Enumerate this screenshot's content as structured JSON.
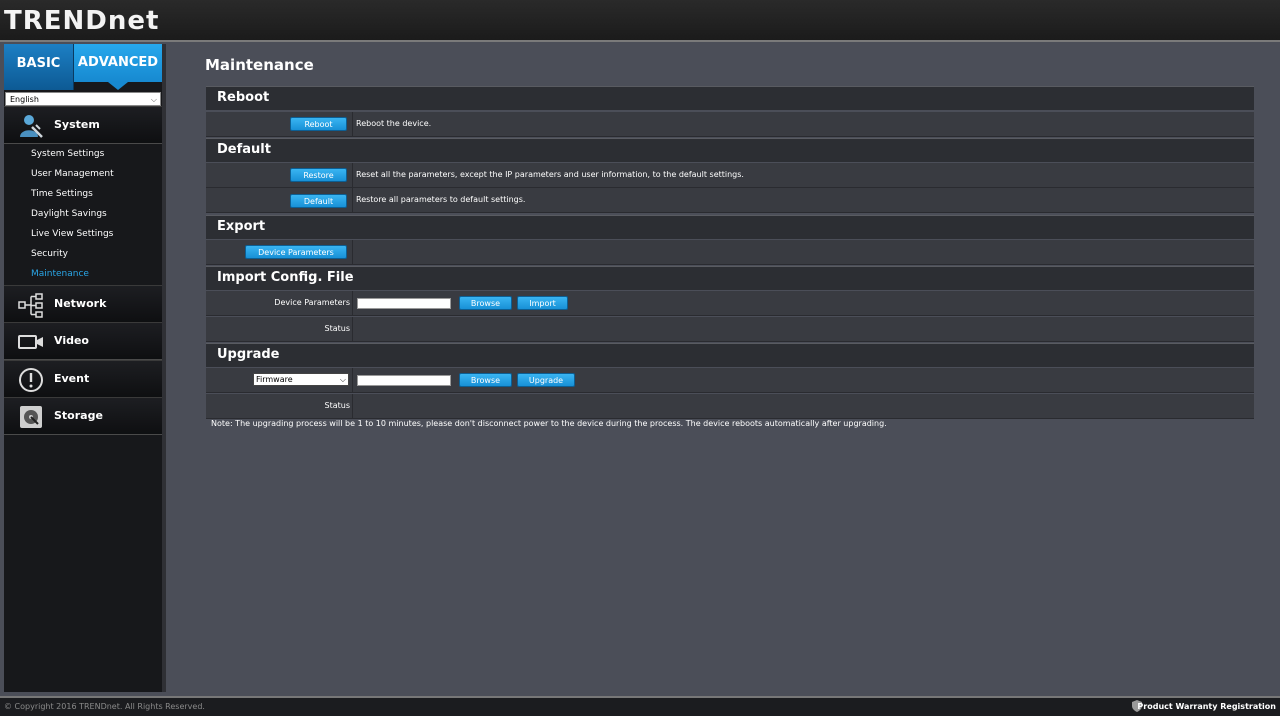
{
  "header": {
    "brand": "TRENDnet"
  },
  "mode_tabs": {
    "basic": "BASIC",
    "advanced": "ADVANCED"
  },
  "language": {
    "selected": "English"
  },
  "nav": {
    "system": "System",
    "system_items": [
      "System Settings",
      "User Management",
      "Time Settings",
      "Daylight Savings",
      "Live View Settings",
      "Security",
      "Maintenance"
    ],
    "active_item": "Maintenance",
    "network": "Network",
    "video": "Video",
    "event": "Event",
    "storage": "Storage"
  },
  "page": {
    "title": "Maintenance"
  },
  "reboot": {
    "header": "Reboot",
    "button": "Reboot",
    "desc": "Reboot the device."
  },
  "default": {
    "header": "Default",
    "restore_button": "Restore",
    "restore_desc": "Reset all the parameters, except the IP parameters and user information, to the default settings.",
    "default_button": "Default",
    "default_desc": "Restore all parameters to default settings."
  },
  "export": {
    "header": "Export",
    "button": "Device Parameters"
  },
  "import": {
    "header": "Import Config. File",
    "label": "Device Parameters",
    "file_value": "",
    "browse_button": "Browse",
    "import_button": "Import",
    "status_label": "Status",
    "status_value": ""
  },
  "upgrade": {
    "header": "Upgrade",
    "select_value": "Firmware",
    "file_value": "",
    "browse_button": "Browse",
    "upgrade_button": "Upgrade",
    "status_label": "Status",
    "status_value": ""
  },
  "note": "Note: The upgrading process will be 1 to 10 minutes, please don't disconnect power to the device during the process. The device reboots automatically after upgrading.",
  "footer": {
    "copyright": "© Copyright 2016 TRENDnet. All Rights Reserved.",
    "warranty": "Product Warranty Registration"
  }
}
